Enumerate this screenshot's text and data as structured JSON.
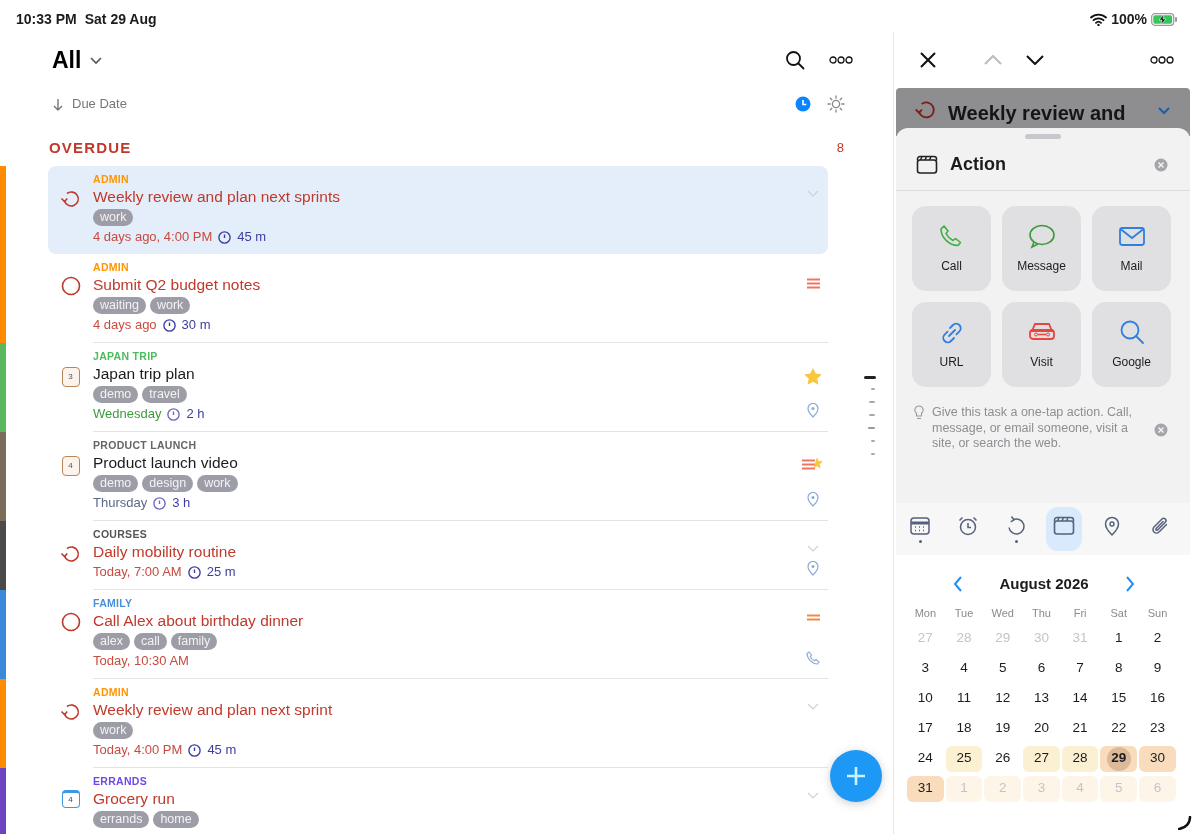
{
  "status_bar": {
    "time": "10:33 PM",
    "date": "Sat 29 Aug",
    "battery": "100%",
    "charging": true
  },
  "list": {
    "title": "All",
    "sort": "Due Date",
    "section": {
      "title": "OVERDUE",
      "count": "8"
    },
    "tasks": [
      {
        "selected": true,
        "color": "#ff8c00",
        "category": {
          "label": "ADMIN",
          "color": "#ff9500"
        },
        "kind": "repeat",
        "title": "Weekly review and plan next sprints",
        "overdue": true,
        "tags": [
          "work"
        ],
        "date": {
          "text": "4 days ago, 4:00 PM",
          "kind": "overdue"
        },
        "duration": "45 m",
        "badges": [
          {
            "kind": "chevron"
          }
        ]
      },
      {
        "selected": false,
        "color": "#ff8c00",
        "category": {
          "label": "ADMIN",
          "color": "#ff9500"
        },
        "kind": "circle",
        "title": "Submit Q2 budget notes",
        "overdue": true,
        "tags": [
          "waiting",
          "work"
        ],
        "date": {
          "text": "4 days ago",
          "kind": "overdue"
        },
        "duration": "30 m",
        "badges": [
          {
            "kind": "priority-high"
          }
        ]
      },
      {
        "selected": false,
        "color": "#5cb85c",
        "category": {
          "label": "JAPAN TRIP",
          "color": "#4cbb5c"
        },
        "kind": "project",
        "icon_number": "3",
        "title": "Japan trip plan",
        "overdue": false,
        "tags": [
          "demo",
          "travel"
        ],
        "date": {
          "text": "Wednesday",
          "kind": "soon"
        },
        "duration": "2 h",
        "badges": [
          {
            "kind": "star"
          },
          {
            "kind": "pin"
          }
        ]
      },
      {
        "selected": false,
        "color": "#7a6e5a",
        "category": {
          "label": "PRODUCT LAUNCH",
          "color": "#666666"
        },
        "kind": "project",
        "icon_number": "4",
        "title": "Product launch video",
        "overdue": false,
        "tags": [
          "demo",
          "design",
          "work"
        ],
        "date": {
          "text": "Thursday",
          "kind": "later"
        },
        "duration": "3 h",
        "badges": [
          {
            "kind": "priority-star"
          },
          {
            "kind": "pin"
          }
        ]
      },
      {
        "selected": false,
        "color": "#4a4a4a",
        "category": {
          "label": "COURSES",
          "color": "#555555"
        },
        "kind": "repeat",
        "title": "Daily mobility routine",
        "overdue": true,
        "date": {
          "text": "Today, 7:00 AM",
          "kind": "overdue"
        },
        "duration": "25 m",
        "badges": [
          {
            "kind": "chevron"
          },
          {
            "kind": "pin"
          }
        ]
      },
      {
        "selected": false,
        "color": "#3b8ad9",
        "category": {
          "label": "FAMILY",
          "color": "#4a90d9"
        },
        "kind": "circle",
        "title": "Call Alex about birthday dinner",
        "overdue": true,
        "tags": [
          "alex",
          "call",
          "family"
        ],
        "date": {
          "text": "Today, 10:30 AM",
          "kind": "overdue"
        },
        "badges": [
          {
            "kind": "priority-medium"
          },
          {
            "kind": "phone"
          }
        ]
      },
      {
        "selected": false,
        "color": "#ff8c00",
        "category": {
          "label": "ADMIN",
          "color": "#ff9500"
        },
        "kind": "repeat",
        "title": "Weekly review and plan next sprint",
        "overdue": true,
        "tags": [
          "work"
        ],
        "date": {
          "text": "Today, 4:00 PM",
          "kind": "overdue"
        },
        "duration": "45 m",
        "badges": [
          {
            "kind": "chevron"
          }
        ]
      },
      {
        "selected": false,
        "color": "#6f42c1",
        "category": {
          "label": "ERRANDS",
          "color": "#7048e8"
        },
        "kind": "calendar",
        "icon_number": "4",
        "title": "Grocery run",
        "overdue": true,
        "tags": [
          "errands",
          "home"
        ],
        "badges": [
          {
            "kind": "chevron"
          }
        ]
      }
    ]
  },
  "detail": {
    "behind_title": "Weekly review and",
    "sheet": {
      "title": "Action",
      "actions": [
        {
          "label": "Call",
          "kind": "call"
        },
        {
          "label": "Message",
          "kind": "message"
        },
        {
          "label": "Mail",
          "kind": "mail"
        },
        {
          "label": "URL",
          "kind": "url"
        },
        {
          "label": "Visit",
          "kind": "visit"
        },
        {
          "label": "Google",
          "kind": "google"
        }
      ],
      "hint": "Give this task a one-tap action. Call, message, or email someone, visit a site, or search the web."
    },
    "tabs": [
      {
        "kind": "date",
        "selected": false,
        "dot": true
      },
      {
        "kind": "alarm",
        "selected": false,
        "dot": false
      },
      {
        "kind": "repeat",
        "selected": false,
        "dot": true
      },
      {
        "kind": "action",
        "selected": true,
        "dot": false
      },
      {
        "kind": "location",
        "selected": false,
        "dot": false
      },
      {
        "kind": "attachment",
        "selected": false,
        "dot": false
      }
    ],
    "calendar": {
      "month": "August 2026",
      "weekdays": [
        "Mon",
        "Tue",
        "Wed",
        "Thu",
        "Fri",
        "Sat",
        "Sun"
      ],
      "weeks": [
        [
          {
            "label": "27",
            "muted": true,
            "kind": "plain",
            "today": false
          },
          {
            "label": "28",
            "muted": true,
            "kind": "plain",
            "today": false
          },
          {
            "label": "29",
            "muted": true,
            "kind": "plain",
            "today": false
          },
          {
            "label": "30",
            "muted": true,
            "kind": "plain",
            "today": false
          },
          {
            "label": "31",
            "muted": true,
            "kind": "plain",
            "today": false
          },
          {
            "label": "1",
            "muted": false,
            "kind": "plain",
            "today": false
          },
          {
            "label": "2",
            "muted": false,
            "kind": "plain",
            "today": false
          }
        ],
        [
          {
            "label": "3",
            "muted": false,
            "kind": "plain",
            "today": false
          },
          {
            "label": "4",
            "muted": false,
            "kind": "plain",
            "today": false
          },
          {
            "label": "5",
            "muted": false,
            "kind": "plain",
            "today": false
          },
          {
            "label": "6",
            "muted": false,
            "kind": "plain",
            "today": false
          },
          {
            "label": "7",
            "muted": false,
            "kind": "plain",
            "today": false
          },
          {
            "label": "8",
            "muted": false,
            "kind": "plain",
            "today": false
          },
          {
            "label": "9",
            "muted": false,
            "kind": "plain",
            "today": false
          }
        ],
        [
          {
            "label": "10",
            "muted": false,
            "kind": "plain",
            "today": false
          },
          {
            "label": "11",
            "muted": false,
            "kind": "plain",
            "today": false
          },
          {
            "label": "12",
            "muted": false,
            "kind": "plain",
            "today": false
          },
          {
            "label": "13",
            "muted": false,
            "kind": "plain",
            "today": false
          },
          {
            "label": "14",
            "muted": false,
            "kind": "plain",
            "today": false
          },
          {
            "label": "15",
            "muted": false,
            "kind": "plain",
            "today": false
          },
          {
            "label": "16",
            "muted": false,
            "kind": "plain",
            "today": false
          }
        ],
        [
          {
            "label": "17",
            "muted": false,
            "kind": "plain",
            "today": false
          },
          {
            "label": "18",
            "muted": false,
            "kind": "plain",
            "today": false
          },
          {
            "label": "19",
            "muted": false,
            "kind": "plain",
            "today": false
          },
          {
            "label": "20",
            "muted": false,
            "kind": "plain",
            "today": false
          },
          {
            "label": "21",
            "muted": false,
            "kind": "plain",
            "today": false
          },
          {
            "label": "22",
            "muted": false,
            "kind": "plain",
            "today": false
          },
          {
            "label": "23",
            "muted": false,
            "kind": "plain",
            "today": false
          }
        ],
        [
          {
            "label": "24",
            "muted": false,
            "kind": "plain",
            "today": false
          },
          {
            "label": "25",
            "muted": false,
            "kind": "light",
            "today": false
          },
          {
            "label": "26",
            "muted": false,
            "kind": "plain",
            "today": false
          },
          {
            "label": "27",
            "muted": false,
            "kind": "light",
            "today": false
          },
          {
            "label": "28",
            "muted": false,
            "kind": "light",
            "today": false
          },
          {
            "label": "29",
            "muted": false,
            "kind": "warm",
            "today": true
          },
          {
            "label": "30",
            "muted": false,
            "kind": "warm",
            "today": false
          }
        ],
        [
          {
            "label": "31",
            "muted": false,
            "kind": "warm",
            "today": false
          },
          {
            "label": "1",
            "muted": true,
            "kind": "faint",
            "today": false
          },
          {
            "label": "2",
            "muted": true,
            "kind": "faint",
            "today": false
          },
          {
            "label": "3",
            "muted": true,
            "kind": "faint",
            "today": false
          },
          {
            "label": "4",
            "muted": true,
            "kind": "faint",
            "today": false
          },
          {
            "label": "5",
            "muted": true,
            "kind": "faint",
            "today": false
          },
          {
            "label": "6",
            "muted": true,
            "kind": "faint",
            "today": false
          }
        ]
      ]
    }
  }
}
